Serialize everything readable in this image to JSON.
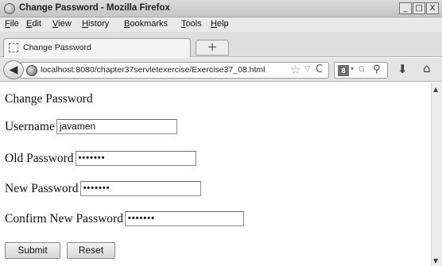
{
  "window": {
    "title": "Change Password - Mozilla Firefox",
    "controls": {
      "minimize": "_",
      "maximize": "□",
      "close": "X"
    }
  },
  "menu": [
    {
      "label": "File",
      "access": "F",
      "rest": "ile"
    },
    {
      "label": "Edit",
      "access": "E",
      "rest": "dit"
    },
    {
      "label": "View",
      "access": "V",
      "rest": "iew"
    },
    {
      "label": "History",
      "access": "H",
      "rest": "istory"
    },
    {
      "label": "Bookmarks",
      "access": "B",
      "rest": "ookmarks"
    },
    {
      "label": "Tools",
      "access": "T",
      "rest": "ools"
    },
    {
      "label": "Help",
      "access": "H",
      "rest": "elp"
    }
  ],
  "tabs": [
    {
      "title": "Change Password",
      "active": true
    }
  ],
  "new_tab_label": "+",
  "navbar": {
    "url": "localhost:8080/chapter37servletexercise/Exercise37_08.html",
    "search_engine_icon": "google-icon",
    "search_placeholder": "G",
    "icons": [
      "back-arrow-icon",
      "globe-icon",
      "star-icon",
      "dropdown-arrow-icon",
      "reload-icon",
      "search-engine-icon",
      "magnifier-icon",
      "download-icon",
      "home-icon"
    ]
  },
  "page": {
    "heading": "Change Password",
    "fields": {
      "username": {
        "label": "Username",
        "value": "javamen"
      },
      "old_password": {
        "label": "Old Password",
        "value": "•••••••"
      },
      "new_password": {
        "label": "New Password",
        "value": "•••••••"
      },
      "confirm_password": {
        "label": "Confirm New Password",
        "value": "•••••••"
      }
    },
    "buttons": {
      "submit": "Submit",
      "reset": "Reset"
    }
  }
}
